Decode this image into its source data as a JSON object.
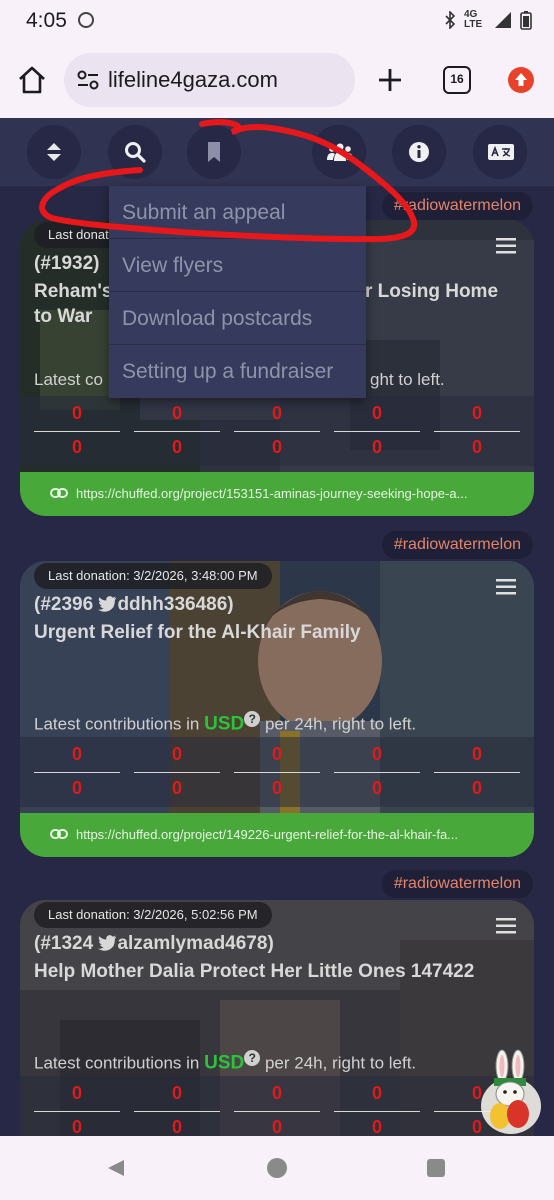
{
  "status": {
    "time": "4:05",
    "network": "4G LTE"
  },
  "browser": {
    "url": "lifeline4gaza.com",
    "tab_count": "16"
  },
  "toolbar": {
    "icons": [
      "sort-icon",
      "search-icon",
      "bookmark-icon",
      "people-icon",
      "info-icon",
      "translate-icon"
    ]
  },
  "dropdown": {
    "items": [
      {
        "label": "Submit an appeal"
      },
      {
        "label": "View flyers"
      },
      {
        "label": "Download postcards"
      },
      {
        "label": "Setting up a fundraiser"
      }
    ]
  },
  "cards": [
    {
      "hashtag": "#radiowatermelon",
      "last_donation": "Last donation:",
      "id": "(#1932)",
      "title_left": "Reham's",
      "title_right": "r Losing Home",
      "title_line2": "to War",
      "latest_left": "Latest co",
      "latest_right": "ght to left.",
      "values": [
        "0",
        "0",
        "0",
        "0",
        "0",
        "0",
        "0",
        "0",
        "0",
        "0"
      ],
      "link": "https://chuffed.org/project/153151-aminas-journey-seeking-hope-a..."
    },
    {
      "hashtag": "#radiowatermelon",
      "last_donation": "Last donation:  3/2/2026, 3:48:00 PM",
      "id": "(#2396 ",
      "handle": "ddhh336486)",
      "title": "Urgent Relief for the Al-Khair Family",
      "latest_prefix": "Latest contributions in ",
      "currency": "USD",
      "latest_suffix": " per 24h, right to left.",
      "values": [
        "0",
        "0",
        "0",
        "0",
        "0",
        "0",
        "0",
        "0",
        "0",
        "0"
      ],
      "link": "https://chuffed.org/project/149226-urgent-relief-for-the-al-khair-fa..."
    },
    {
      "hashtag": "#radiowatermelon",
      "last_donation": "Last donation:  3/2/2026, 5:02:56 PM",
      "id": "(#1324 ",
      "handle": "alzamlymad4678)",
      "title": "Help Mother Dalia Protect Her Little Ones 147422",
      "latest_prefix": "Latest contributions in ",
      "currency": "USD",
      "latest_suffix": " per 24h, right to left.",
      "values": [
        "0",
        "0",
        "0",
        "0",
        "0",
        "0",
        "0",
        "0",
        "0",
        "0"
      ]
    }
  ],
  "help_mark": "?"
}
